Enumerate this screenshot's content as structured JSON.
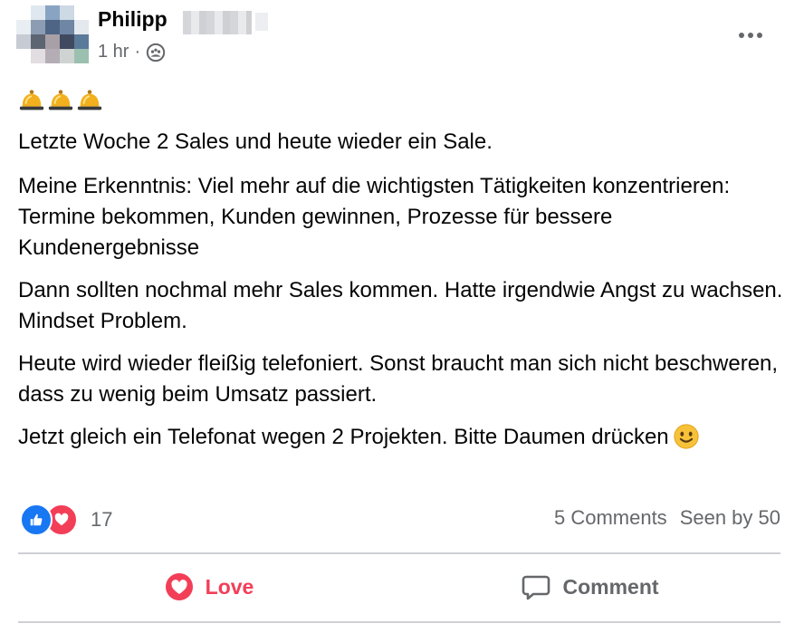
{
  "post": {
    "author_name": "Philipp",
    "time": "1 hr",
    "separator": "·",
    "audience_icon": "group-icon",
    "more_icon": "more-horizontal-icon",
    "leading_emoji": [
      "bell-icon",
      "bell-icon",
      "bell-icon"
    ],
    "paragraphs": [
      "Letzte Woche 2 Sales und heute wieder ein Sale.",
      "Meine Erkenntnis: Viel mehr auf die wichtigsten Tätigkeiten konzentrieren: Termine bekommen, Kunden gewinnen, Prozesse für bessere Kundenergebnisse",
      "Dann sollten nochmal mehr Sales kommen. Hatte irgendwie Angst zu wachsen. Mindset Problem.",
      "Heute wird wieder fleißig telefoniert. Sonst braucht man sich nicht beschweren, dass zu wenig beim Umsatz passiert.",
      "Jetzt gleich ein Telefonat wegen 2 Projekten. Bitte Daumen drücken"
    ],
    "trailing_emoji": "smiling-face-icon"
  },
  "reactions": {
    "icons": [
      "like-icon",
      "love-icon"
    ],
    "count": "17"
  },
  "stats": {
    "comments": "5 Comments",
    "seen": "Seen by 50"
  },
  "actions": {
    "love_label": "Love",
    "comment_label": "Comment"
  },
  "colors": {
    "love": "#f33e58",
    "like": "#1877f2",
    "secondary_text": "#65676b",
    "divider": "#ced0d4"
  }
}
